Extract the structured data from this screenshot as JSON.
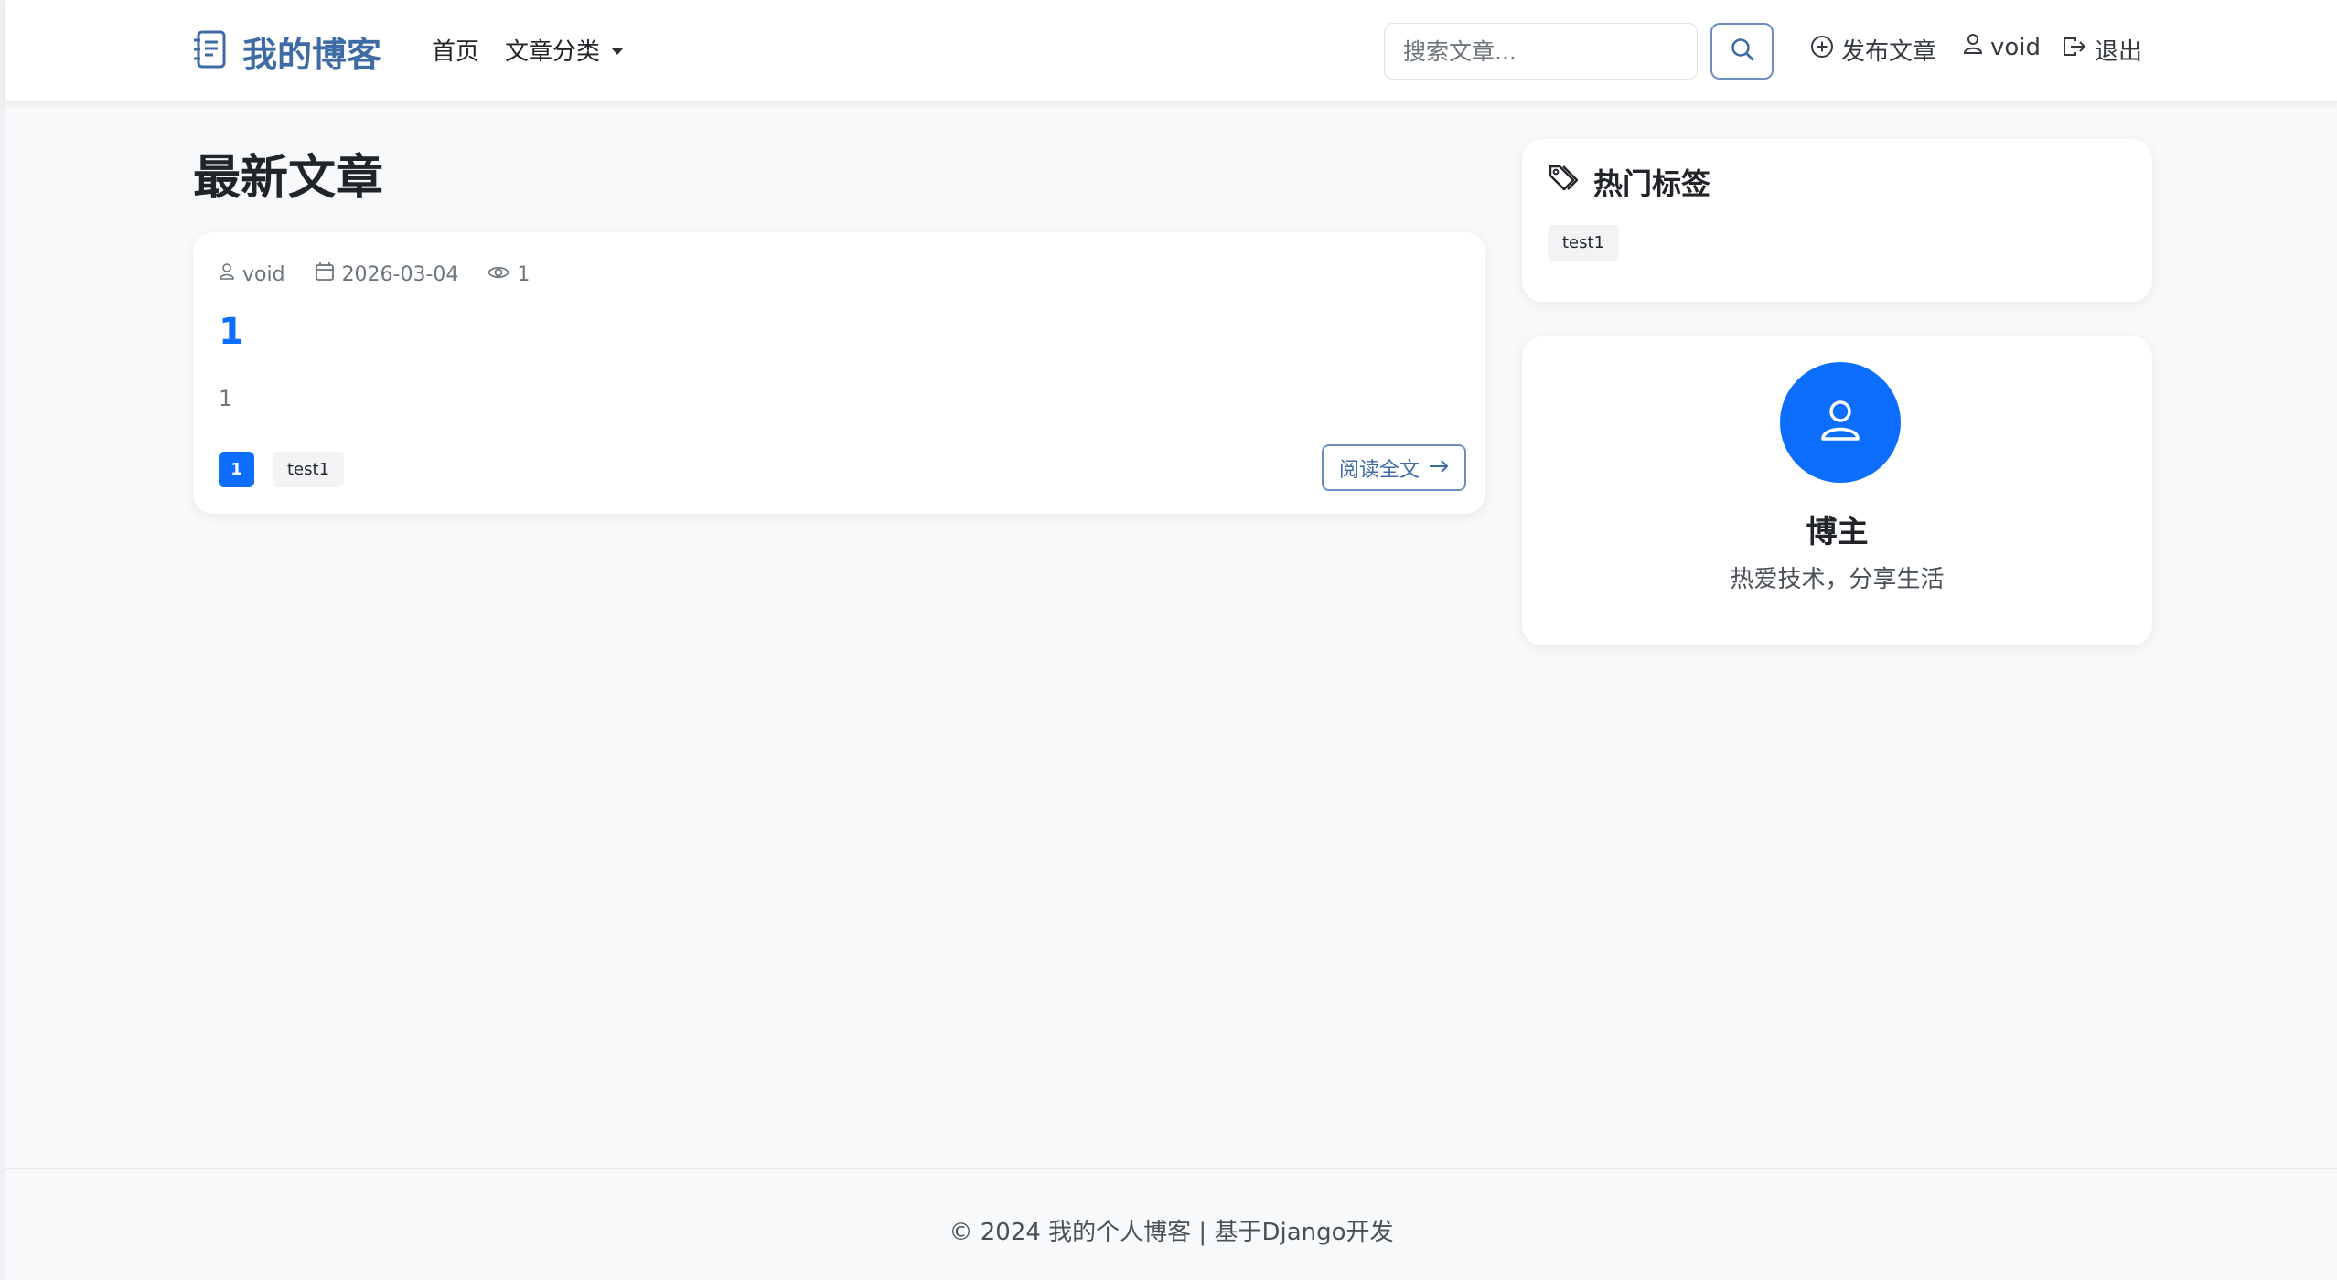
{
  "navbar": {
    "brand": "我的博客",
    "links": {
      "home": "首页",
      "categories": "文章分类"
    },
    "search": {
      "placeholder": "搜索文章..."
    },
    "publish": "发布文章",
    "username": "void",
    "logout": "退出"
  },
  "main": {
    "heading": "最新文章",
    "posts": [
      {
        "author": "void",
        "date": "2026-03-04",
        "views": "1",
        "title": "1",
        "excerpt": "1",
        "category": "1",
        "tags": [
          "test1"
        ],
        "read_more": "阅读全文"
      }
    ]
  },
  "sidebar": {
    "hot_tags": {
      "title": "热门标签",
      "tags": [
        "test1"
      ]
    },
    "author": {
      "name": "博主",
      "bio": "热爱技术，分享生活"
    }
  },
  "footer": {
    "text": "© 2024 我的个人博客 | 基于Django开发"
  },
  "colors": {
    "primary": "#0d6efd",
    "brand": "#3e6ba6",
    "background": "#f8f9fa"
  },
  "icons": {
    "brand": "journal-text-icon",
    "search": "search-icon",
    "publish": "plus-circle-icon",
    "user": "person-icon",
    "logout": "box-arrow-right-icon",
    "date": "calendar-icon",
    "views": "eye-icon",
    "read_more": "arrow-right-icon",
    "tags": "tags-icon",
    "avatar": "person-icon"
  }
}
